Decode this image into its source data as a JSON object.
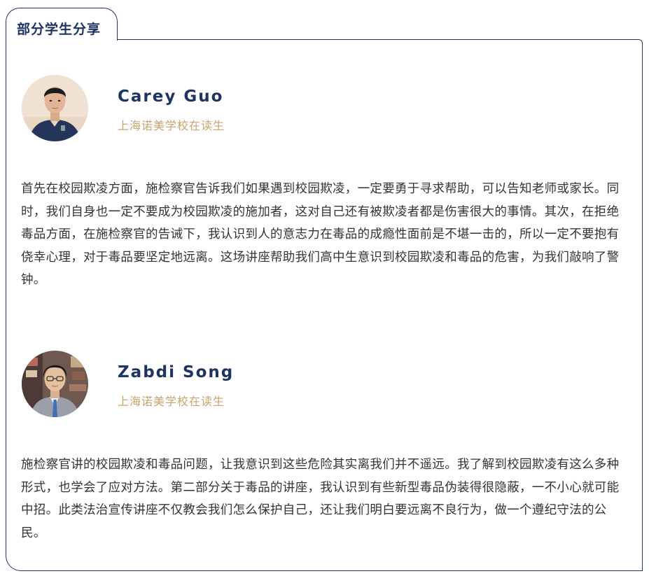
{
  "section": {
    "title": "部分学生分享"
  },
  "students": [
    {
      "name": "Carey Guo",
      "school": "上海诺美学校在读生",
      "photo": "student-photo",
      "text": "首先在校园欺凌方面，施检察官告诉我们如果遇到校园欺凌，一定要勇于寻求帮助，可以告知老师或家长。同时，我们自身也一定不要成为校园欺凌的施加者，这对自己还有被欺凌者都是伤害很大的事情。其次，在拒绝毒品方面，在施检察官的告诫下，我认识到人的意志力在毒品的成瘾性面前是不堪一击的，所以一定不要抱有侥幸心理，对于毒品要坚定地远离。这场讲座帮助我们高中生意识到校园欺凌和毒品的危害，为我们敲响了警钟。"
    },
    {
      "name": "Zabdi Song",
      "school": "上海诺美学校在读生",
      "photo": "student-photo",
      "text": "施检察官讲的校园欺凌和毒品问题，让我意识到这些危险其实离我们并不遥远。我了解到校园欺凌有这么多种形式，也学会了应对方法。第二部分关于毒品的讲座，我认识到有些新型毒品伪装得很隐蔽，一不小心就可能中招。此类法治宣传讲座不仅教会我们怎么保护自己，还让我们明白要远离不良行为，做一个遵纪守法的公民。"
    }
  ],
  "colors": {
    "navy": "#1e3461",
    "gold": "#c8a36e",
    "body_text": "#333333"
  }
}
